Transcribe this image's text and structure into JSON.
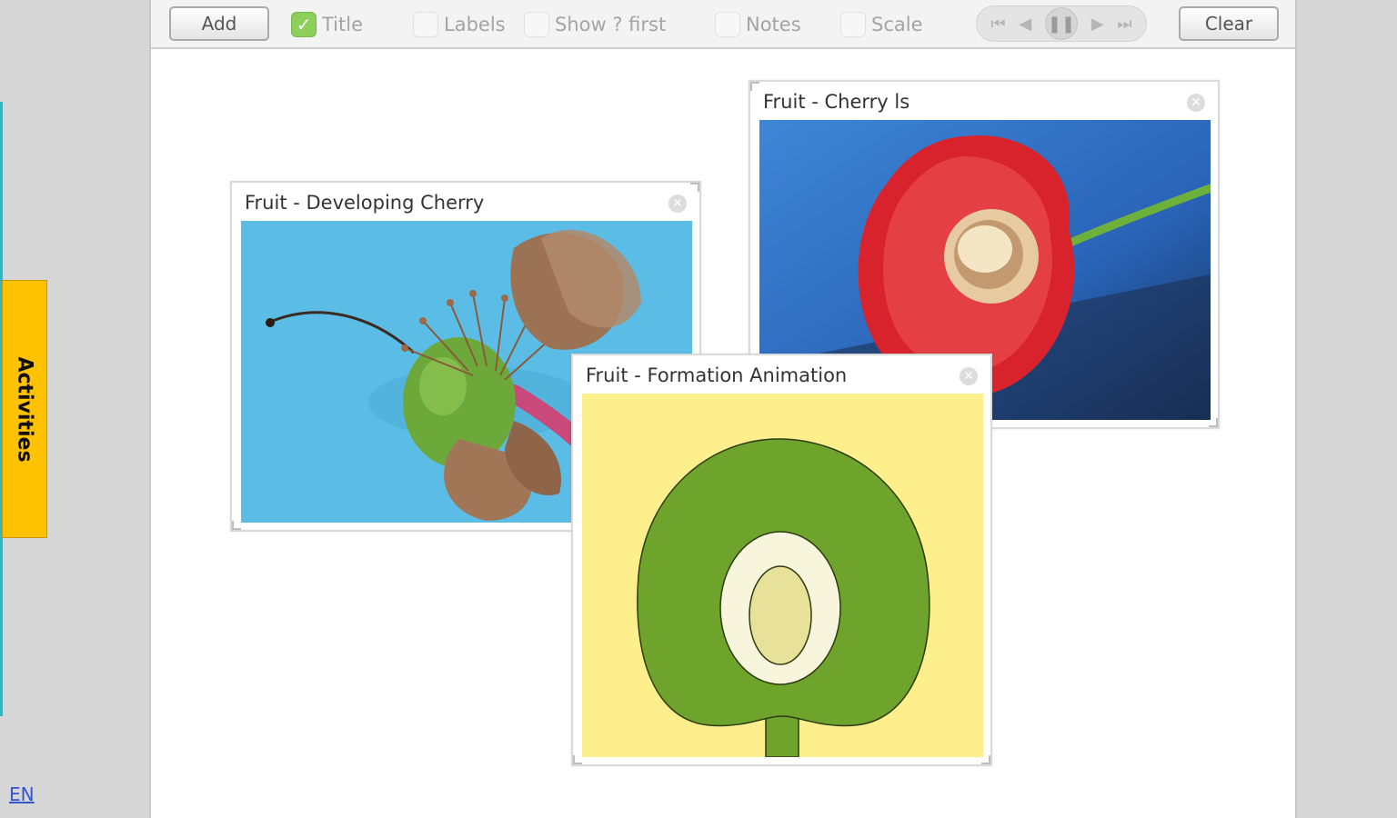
{
  "toolbar": {
    "add_label": "Add",
    "clear_label": "Clear",
    "checkboxes": [
      {
        "label": "Title",
        "checked": true
      },
      {
        "label": "Labels",
        "checked": false
      },
      {
        "label": "Show ? first",
        "checked": false
      },
      {
        "label": "Notes",
        "checked": false
      },
      {
        "label": "Scale",
        "checked": false
      }
    ],
    "player": {
      "first": "⏮",
      "prev": "◀",
      "pause": "❚❚",
      "next": "▶",
      "last": "⏭"
    }
  },
  "sidebar": {
    "tab_label": "Activities",
    "language": "EN",
    "accent": "#ffc200"
  },
  "panels": [
    {
      "title": "Fruit - Developing Cherry",
      "close_icon": "close-icon"
    },
    {
      "title": "Fruit - Cherry ls",
      "close_icon": "close-icon"
    },
    {
      "title": "Fruit - Formation Animation",
      "close_icon": "close-icon"
    }
  ]
}
